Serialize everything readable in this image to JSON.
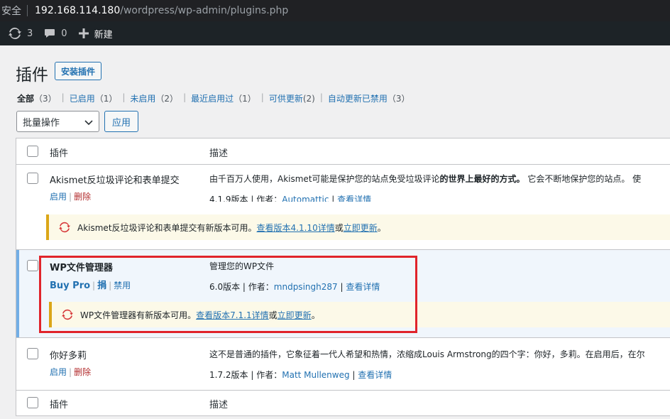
{
  "browser": {
    "secure_label": "安全",
    "url_host": "192.168.114.180",
    "url_path": "/wordpress/wp-admin/plugins.php"
  },
  "adminbar": {
    "updates_count": "3",
    "comments_count": "0",
    "new_label": "新建"
  },
  "page": {
    "title": "插件",
    "add_button": "安装插件"
  },
  "filters": [
    {
      "label": "全部",
      "count": "（3）",
      "current": true
    },
    {
      "label": "已启用",
      "count": "（1）"
    },
    {
      "label": "未启用",
      "count": "（2）"
    },
    {
      "label": "最近启用过",
      "count": "（1）"
    },
    {
      "label": "可供更新",
      "count": "(2)"
    },
    {
      "label": "自动更新已禁用",
      "count": "（3）"
    }
  ],
  "bulk": {
    "select_value": "批量操作",
    "apply_label": "应用"
  },
  "table": {
    "col_plugin": "插件",
    "col_desc": "描述",
    "plugins": [
      {
        "name": "Akismet反垃圾评论和表单提交",
        "action1": "启用",
        "action2": "删除",
        "desc_part1": "由千百万人使用，Akismet可能是保护您的站点免受垃圾评论",
        "desc_bold": "的世界上最好的方式。",
        "desc_part2": " 它会不断地保护您的站点。 使",
        "version": "4.1.9版本",
        "author_prefix": "作者：",
        "author": "Automattic",
        "details": "查看详情",
        "update_text": "Akismet反垃圾评论和表单提交有新版本可用。",
        "update_link1": "查看版本4.1.10详情",
        "update_or": "或",
        "update_link2": "立即更新",
        "update_end": "。"
      },
      {
        "name": "WP文件管理器",
        "action1": "Buy Pro",
        "action2": "捐",
        "action3": "禁用",
        "desc_main": "管理您的WP文件",
        "version": "6.0版本",
        "author_prefix": "作者：",
        "author": "mndpsingh287",
        "details": "查看详情",
        "update_text": "WP文件管理器有新版本可用。",
        "update_link1": "查看版本7.1.1详情",
        "update_or": "或",
        "update_link2": "立即更新",
        "update_end": "。"
      },
      {
        "name": "你好多莉",
        "action1": "启用",
        "action2": "删除",
        "desc_main": "这不是普通的插件，它象征着一代人希望和热情，浓缩成Louis Armstrong的四个字：你好，多莉。在启用后，在尔",
        "version": "1.7.2版本",
        "author_prefix": "作者：",
        "author": "Matt Mullenweg",
        "details": "查看详情"
      }
    ]
  },
  "colors": {
    "link": "#2271b1",
    "delete": "#b32d2e",
    "highlight_box": "#e0242b",
    "notice_border": "#dba617",
    "update_icon": "#d63638"
  }
}
